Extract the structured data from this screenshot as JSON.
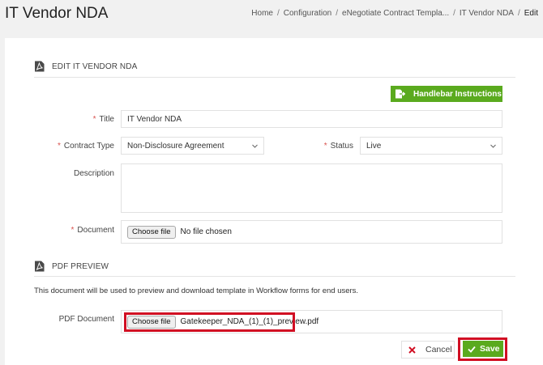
{
  "header": {
    "title": "IT Vendor NDA",
    "breadcrumb": [
      "Home",
      "Configuration",
      "eNegotiate Contract Templa...",
      "IT Vendor NDA",
      "Edit"
    ]
  },
  "edit_section": {
    "heading": "EDIT IT VENDOR NDA",
    "handlebar_button": "Handlebar Instructions"
  },
  "form": {
    "title_label": "Title",
    "title_value": "IT Vendor NDA",
    "contract_type_label": "Contract Type",
    "contract_type_value": "Non-Disclosure Agreement",
    "status_label": "Status",
    "status_value": "Live",
    "description_label": "Description",
    "description_value": "",
    "document_label": "Document",
    "document_button": "Choose file",
    "document_file": "No file chosen",
    "required_marker": "*"
  },
  "pdf_section": {
    "heading": "PDF PREVIEW",
    "note": "This document will be used to preview and download template in Workflow forms for end users.",
    "pdf_label": "PDF Document",
    "pdf_button": "Choose file",
    "pdf_file": "Gatekeeper_NDA_(1)_(1)_preview.pdf"
  },
  "actions": {
    "cancel": "Cancel",
    "save": "Save"
  },
  "colors": {
    "accent_green": "#5aaa1e",
    "highlight_red": "#d10f23",
    "required_red": "#d9534f"
  }
}
